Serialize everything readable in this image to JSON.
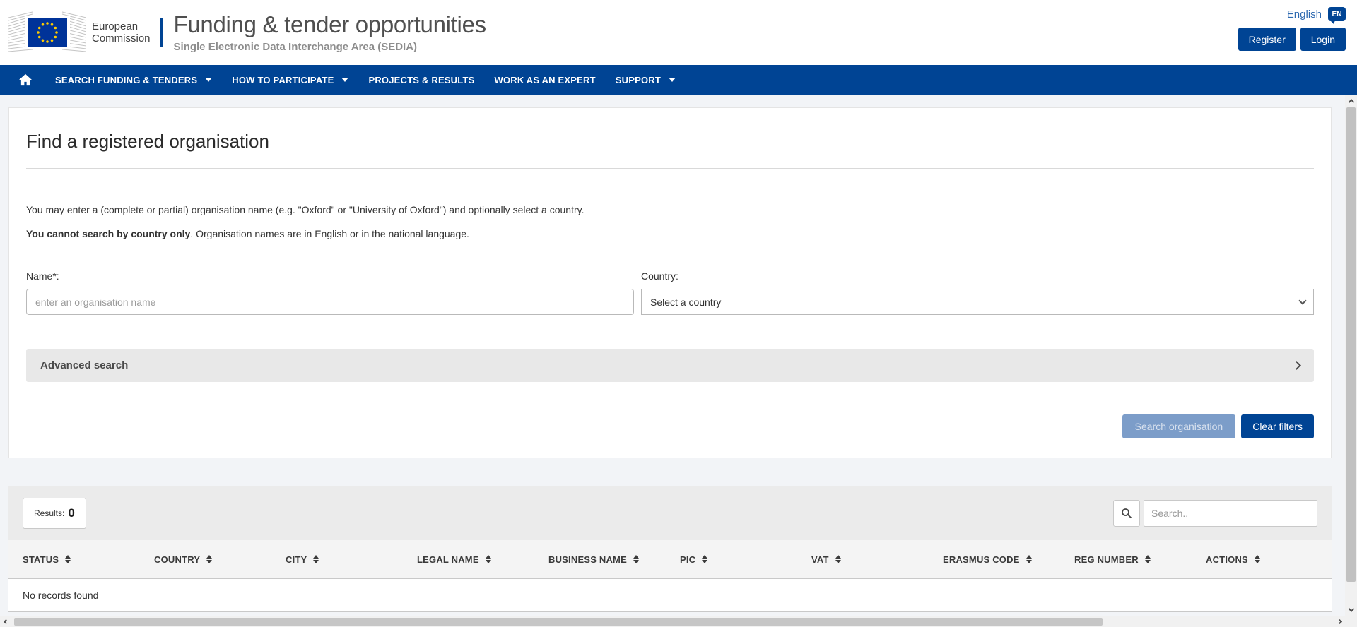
{
  "header": {
    "brand_line1": "European",
    "brand_line2": "Commission",
    "title": "Funding & tender opportunities",
    "subtitle": "Single Electronic Data Interchange Area (SEDIA)",
    "language_label": "English",
    "language_badge": "EN",
    "register_label": "Register",
    "login_label": "Login"
  },
  "navbar": {
    "items": [
      {
        "label": "SEARCH FUNDING & TENDERS"
      },
      {
        "label": "HOW TO PARTICIPATE"
      },
      {
        "label": "PROJECTS & RESULTS"
      },
      {
        "label": "WORK AS AN EXPERT"
      },
      {
        "label": "SUPPORT"
      }
    ]
  },
  "search_card": {
    "heading": "Find a registered organisation",
    "intro": "You may enter a (complete or partial) organisation name (e.g. \"Oxford\" or \"University of Oxford\") and optionally select a country.",
    "note_bold": "You cannot search by country only",
    "note_rest": ". Organisation names are in English or in the national language.",
    "name_label": "Name*:",
    "name_placeholder": "enter an organisation name",
    "country_label": "Country:",
    "country_value": "Select a country",
    "advanced_label": "Advanced search",
    "search_button": "Search organisation",
    "clear_button": "Clear filters"
  },
  "results": {
    "results_label": "Results:",
    "results_count": "0",
    "search_placeholder": "Search..",
    "columns": [
      "STATUS",
      "COUNTRY",
      "CITY",
      "LEGAL NAME",
      "BUSINESS NAME",
      "PIC",
      "VAT",
      "ERASMUS CODE",
      "REG NUMBER",
      "ACTIONS"
    ],
    "no_records": "No records found"
  },
  "colors": {
    "primary_blue": "#004494",
    "flag_blue": "#003399",
    "star_yellow": "#ffcc00",
    "disabled_button": "#7c9dc9"
  }
}
